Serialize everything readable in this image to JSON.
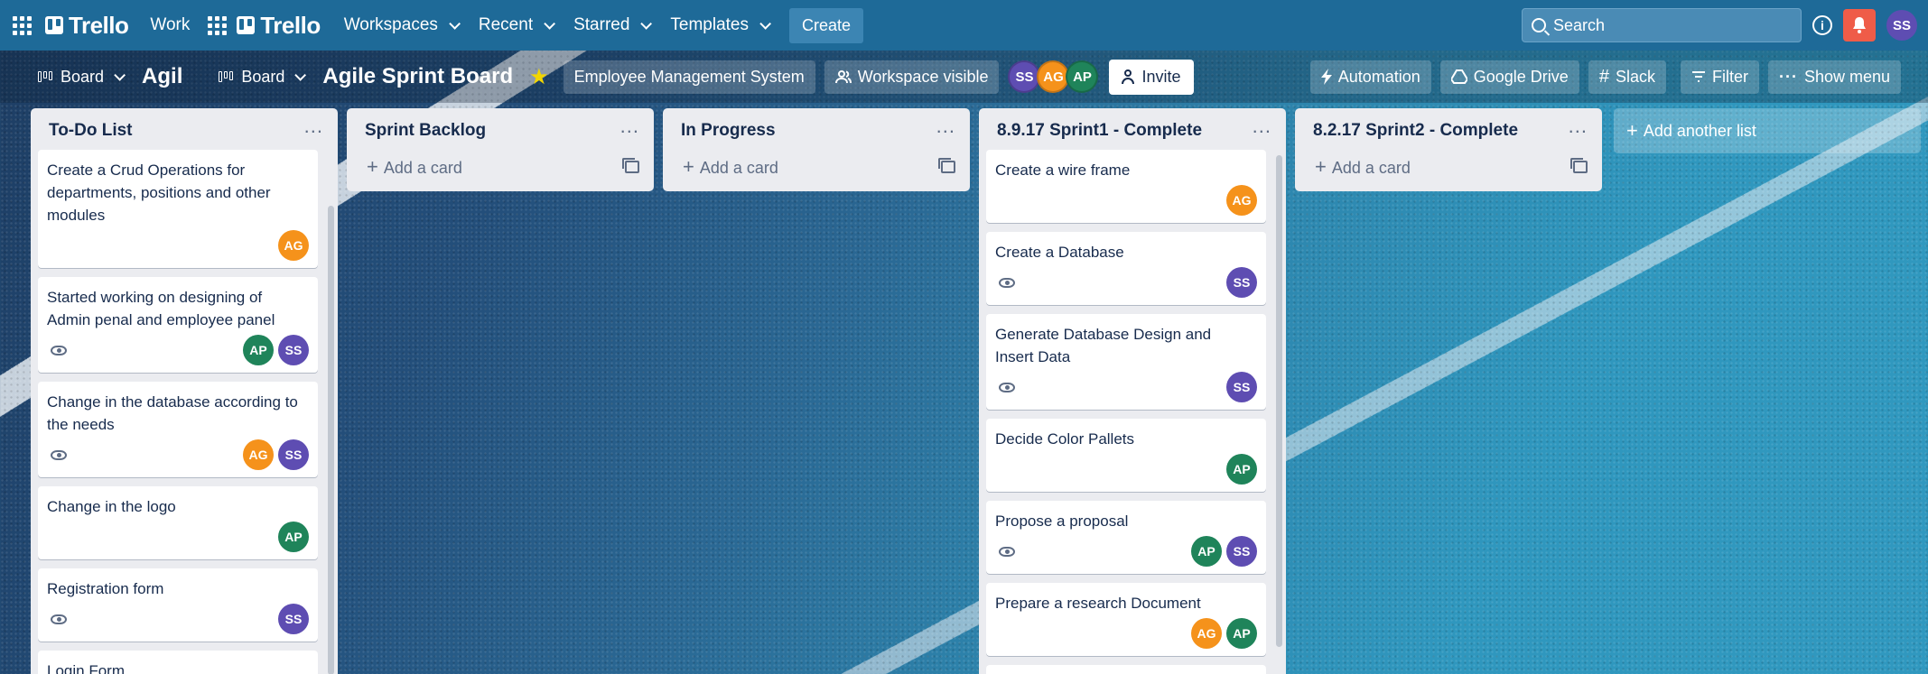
{
  "nav": {
    "brand": "Trello",
    "work_label": "Work",
    "brand2": "Trello",
    "workspaces": "Workspaces",
    "recent": "Recent",
    "starred": "Starred",
    "templates": "Templates",
    "create": "Create",
    "search_placeholder": "Search",
    "user_initials": "SS"
  },
  "board": {
    "view1": "Board",
    "trunc_title": "Agil",
    "view2": "Board",
    "title": "Agile Sprint Board",
    "workspace": "Employee Management System",
    "visibility": "Workspace visible",
    "members": [
      "SS",
      "AG",
      "AP"
    ],
    "invite": "Invite",
    "automation": "Automation",
    "google_drive": "Google Drive",
    "slack": "Slack",
    "filter": "Filter",
    "show_menu": "Show menu"
  },
  "colors": {
    "AG": "#f5921b",
    "AP": "#1f845a",
    "SS": "#5e4db2"
  },
  "lists": [
    {
      "title": "To-Do List",
      "cards": [
        {
          "title": "Create a Crud Operations for departments, positions and other modules",
          "watch": false,
          "members": [
            "AG"
          ]
        },
        {
          "title": "Started working on designing of Admin penal and employee panel",
          "watch": true,
          "members": [
            "AP",
            "SS"
          ]
        },
        {
          "title": "Change in the database according to the needs",
          "watch": true,
          "members": [
            "AG",
            "SS"
          ]
        },
        {
          "title": "Change in the logo",
          "watch": false,
          "members": [
            "AP"
          ]
        },
        {
          "title": "Registration form",
          "watch": true,
          "members": [
            "SS"
          ]
        },
        {
          "title": "Login Form",
          "watch": false,
          "members": []
        }
      ]
    },
    {
      "title": "Sprint Backlog",
      "add_card": "Add a card"
    },
    {
      "title": "In Progress",
      "add_card": "Add a card"
    },
    {
      "title": "8.9.17 Sprint1 - Complete",
      "cards": [
        {
          "title": "Create a wire frame",
          "watch": false,
          "members": [
            "AG"
          ]
        },
        {
          "title": "Create a Database",
          "watch": true,
          "members": [
            "SS"
          ]
        },
        {
          "title": "Generate Database Design and Insert Data",
          "watch": true,
          "members": [
            "SS"
          ]
        },
        {
          "title": "Decide Color Pallets",
          "watch": false,
          "members": [
            "AP"
          ]
        },
        {
          "title": "Propose a proposal",
          "watch": true,
          "members": [
            "AP",
            "SS"
          ]
        },
        {
          "title": "Prepare a research Document",
          "watch": false,
          "members": [
            "AG",
            "AP"
          ]
        }
      ]
    },
    {
      "title": "8.2.17 Sprint2 - Complete",
      "add_card": "Add a card"
    }
  ],
  "add_another_list": "Add another list"
}
